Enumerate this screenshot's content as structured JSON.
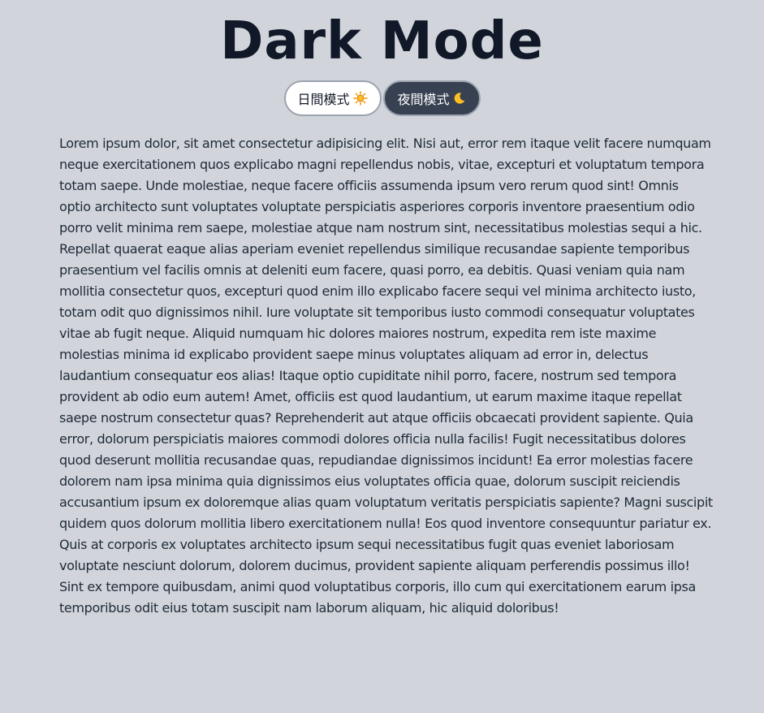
{
  "header": {
    "title": "Dark Mode"
  },
  "toggles": {
    "light_label": "日間模式",
    "light_icon": "sun-icon",
    "dark_label": "夜間模式",
    "dark_icon": "moon-icon",
    "icon_color": "#f59e0b"
  },
  "content": {
    "paragraph": "Lorem ipsum dolor, sit amet consectetur adipisicing elit. Nisi aut, error rem itaque velit facere numquam neque exercitationem quos explicabo magni repellendus nobis, vitae, excepturi et voluptatum tempora totam saepe. Unde molestiae, neque facere officiis assumenda ipsum vero rerum quod sint! Omnis optio architecto sunt voluptates voluptate perspiciatis asperiores corporis inventore praesentium odio porro velit minima rem saepe, molestiae atque nam nostrum sint, necessitatibus molestias sequi a hic. Repellat quaerat eaque alias aperiam eveniet repellendus similique recusandae sapiente temporibus praesentium vel facilis omnis at deleniti eum facere, quasi porro, ea debitis. Quasi veniam quia nam mollitia consectetur quos, excepturi quod enim illo explicabo facere sequi vel minima architecto iusto, totam odit quo dignissimos nihil. Iure voluptate sit temporibus iusto commodi consequatur voluptates vitae ab fugit neque. Aliquid numquam hic dolores maiores nostrum, expedita rem iste maxime molestias minima id explicabo provident saepe minus voluptates aliquam ad error in, delectus laudantium consequatur eos alias! Itaque optio cupiditate nihil porro, facere, nostrum sed tempora provident ab odio eum autem! Amet, officiis est quod laudantium, ut earum maxime itaque repellat saepe nostrum consectetur quas? Reprehenderit aut atque officiis obcaecati provident sapiente. Quia error, dolorum perspiciatis maiores commodi dolores officia nulla facilis! Fugit necessitatibus dolores quod deserunt mollitia recusandae quas, repudiandae dignissimos incidunt! Ea error molestias facere dolorem nam ipsa minima quia dignissimos eius voluptates officia quae, dolorum suscipit reiciendis accusantium ipsum ex doloremque alias quam voluptatum veritatis perspiciatis sapiente? Magni suscipit quidem quos dolorum mollitia libero exercitationem nulla! Eos quod inventore consequuntur pariatur ex. Quis at corporis ex voluptates architecto ipsum sequi necessitatibus fugit quas eveniet laboriosam voluptate nesciunt dolorum, dolorem ducimus, provident sapiente aliquam perferendis possimus illo! Sint ex tempore quibusdam, animi quod voluptatibus corporis, illo cum qui exercitationem earum ipsa temporibus odit eius totam suscipit nam laborum aliquam, hic aliquid doloribus!"
  }
}
